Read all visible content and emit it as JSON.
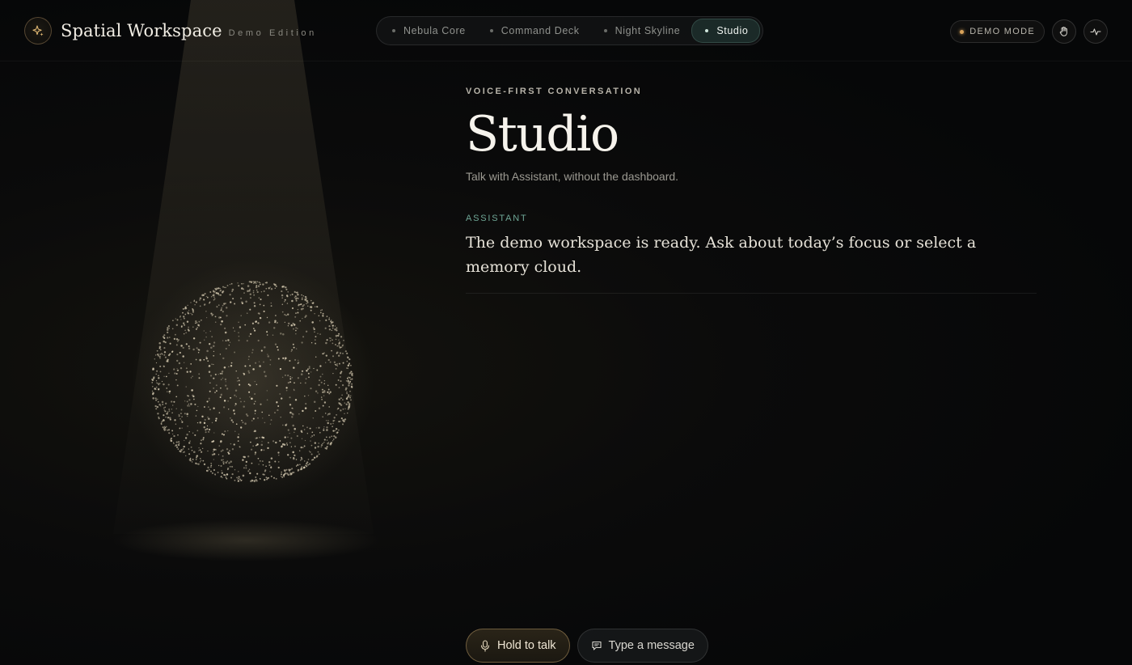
{
  "brand": {
    "title": "Spatial Workspace",
    "subtitle": "Demo Edition",
    "icon": "sparkle-icon"
  },
  "nav": {
    "items": [
      {
        "label": "Nebula Core",
        "active": false
      },
      {
        "label": "Command Deck",
        "active": false
      },
      {
        "label": "Night Skyline",
        "active": false
      },
      {
        "label": "Studio",
        "active": true
      }
    ]
  },
  "toolbar": {
    "demo_mode_label": "DEMO MODE",
    "gesture_icon": "hand-icon",
    "activity_icon": "pulse-icon"
  },
  "main": {
    "eyebrow": "VOICE-FIRST CONVERSATION",
    "title": "Studio",
    "subtitle": "Talk with Assistant, without the dashboard.",
    "message": {
      "role": "ASSISTANT",
      "text": "The demo workspace is ready. Ask about today’s focus or select a memory cloud."
    }
  },
  "controls": {
    "talk_label": "Hold to talk",
    "talk_icon": "microphone-icon",
    "message_label": "Type a message",
    "message_icon": "chat-bubble-icon"
  },
  "colors": {
    "accent_gold": "#d9a35a",
    "accent_teal": "#6fa796",
    "background": "#070809"
  }
}
